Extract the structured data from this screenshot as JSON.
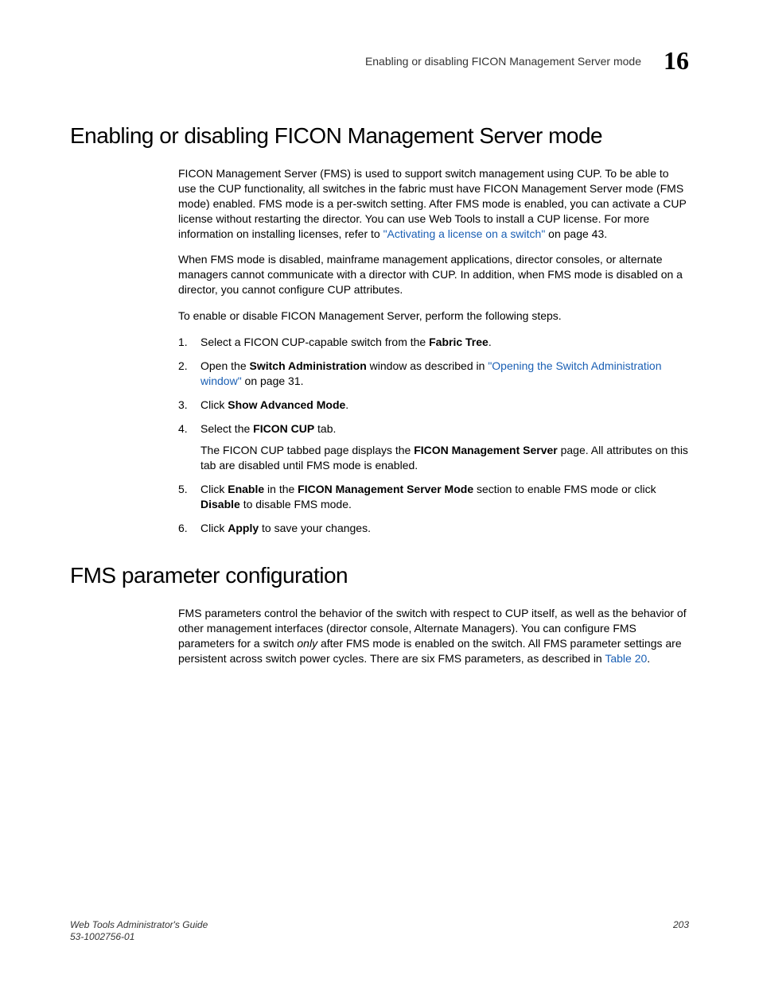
{
  "header": {
    "running_title": "Enabling or disabling FICON Management Server mode",
    "chapter_number": "16"
  },
  "section1": {
    "heading": "Enabling or disabling FICON Management Server mode",
    "p1_a": "FICON Management Server (FMS) is used to support switch management using CUP. To be able to use the CUP functionality, all switches in the fabric must have FICON Management Server mode (FMS mode) enabled. FMS mode is a per-switch setting. After FMS mode is enabled, you can activate a CUP license without restarting the director. You can use Web Tools to install a CUP license. For more information on installing licenses, refer to ",
    "p1_link": "\"Activating a license on a switch\"",
    "p1_b": " on page 43.",
    "p2": "When FMS mode is disabled, mainframe management applications, director consoles, or alternate managers cannot communicate with a director with CUP. In addition, when FMS mode is disabled on a director, you cannot configure CUP attributes.",
    "p3": "To enable or disable FICON Management Server, perform the following steps.",
    "steps": {
      "s1_a": "Select a FICON CUP-capable switch from the ",
      "s1_b": "Fabric Tree",
      "s1_c": ".",
      "s2_a": "Open the ",
      "s2_b": "Switch Administration",
      "s2_c": " window as described in ",
      "s2_link": "\"Opening the Switch Administration window\"",
      "s2_d": " on page 31.",
      "s3_a": "Click ",
      "s3_b": "Show Advanced Mode",
      "s3_c": ".",
      "s4_a": "Select the ",
      "s4_b": "FICON CUP",
      "s4_c": " tab.",
      "s4_sub_a": "The FICON CUP tabbed page displays the ",
      "s4_sub_b": "FICON Management Server",
      "s4_sub_c": " page. All attributes on this tab are disabled until FMS mode is enabled.",
      "s5_a": "Click ",
      "s5_b": "Enable",
      "s5_c": " in the ",
      "s5_d": "FICON Management Server Mode",
      "s5_e": " section to enable FMS mode or click ",
      "s5_f": "Disable",
      "s5_g": " to disable FMS mode.",
      "s6_a": "Click ",
      "s6_b": "Apply",
      "s6_c": " to save your changes."
    }
  },
  "section2": {
    "heading": "FMS parameter configuration",
    "p1_a": "FMS parameters control the behavior of the switch with respect to CUP itself, as well as the behavior of other management interfaces (director console, Alternate Managers). You can configure FMS parameters for a switch ",
    "p1_only": "only",
    "p1_b": " after FMS mode is enabled on the switch. All FMS parameter settings are persistent across switch power cycles. There are six FMS parameters, as described in ",
    "p1_link": "Table 20",
    "p1_c": "."
  },
  "footer": {
    "doc_title": "Web Tools Administrator's Guide",
    "doc_number": "53-1002756-01",
    "page_number": "203"
  }
}
